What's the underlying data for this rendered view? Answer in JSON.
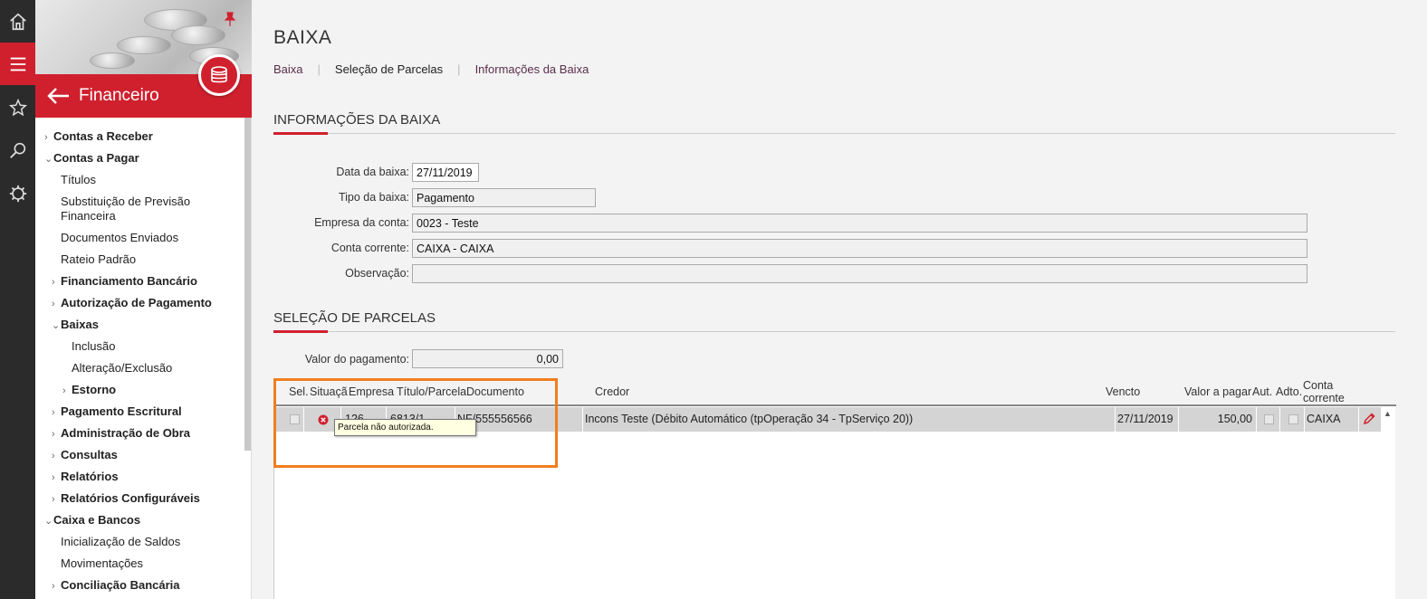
{
  "sidebar": {
    "title": "Financeiro",
    "menu": [
      {
        "label": "Contas a Receber"
      },
      {
        "label": "Contas a Pagar"
      },
      {
        "label": "Títulos"
      },
      {
        "label": "Substituição de Previsão Financeira"
      },
      {
        "label": "Documentos Enviados"
      },
      {
        "label": "Rateio Padrão"
      },
      {
        "label": "Financiamento Bancário"
      },
      {
        "label": "Autorização de Pagamento"
      },
      {
        "label": "Baixas"
      },
      {
        "label": "Inclusão"
      },
      {
        "label": "Alteração/Exclusão"
      },
      {
        "label": "Estorno"
      },
      {
        "label": "Pagamento Escritural"
      },
      {
        "label": "Administração de Obra"
      },
      {
        "label": "Consultas"
      },
      {
        "label": "Relatórios"
      },
      {
        "label": "Relatórios Configuráveis"
      },
      {
        "label": "Caixa e Bancos"
      },
      {
        "label": "Inicialização de Saldos"
      },
      {
        "label": "Movimentações"
      },
      {
        "label": "Conciliação Bancária"
      }
    ]
  },
  "page": {
    "title": "BAIXA",
    "breadcrumbs": [
      "Baixa",
      "Seleção de Parcelas",
      "Informações da Baixa"
    ]
  },
  "info_section": {
    "title": "INFORMAÇÕES DA BAIXA",
    "fields": {
      "data_label": "Data da baixa:",
      "data_value": "27/11/2019",
      "tipo_label": "Tipo da baixa:",
      "tipo_value": "Pagamento",
      "empresa_label": "Empresa da conta:",
      "empresa_value": "0023 - Teste",
      "conta_label": "Conta corrente:",
      "conta_value": "CAIXA - CAIXA",
      "obs_label": "Observação:",
      "obs_value": ""
    }
  },
  "parcelas_section": {
    "title": "SELEÇÃO DE PARCELAS",
    "valor_label": "Valor do pagamento:",
    "valor_value": "0,00",
    "columns": {
      "sel": "Sel.",
      "situacao": "Situaçã",
      "empresa": "Empresa",
      "titulo": "Título/Parcela",
      "documento": "Documento",
      "credor": "Credor",
      "vencto": "Vencto",
      "valor": "Valor a pagar",
      "aut": "Aut.",
      "adto": "Adto.",
      "conta_1": "Conta",
      "conta_2": "corrente"
    },
    "rows": [
      {
        "empresa": "126",
        "titulo": "6813/1",
        "documento": "NF/555556566",
        "credor": "Incons Teste (Débito Automático (tpOperação 34 - TpServiço 20))",
        "vencto": "27/11/2019",
        "valor": "150,00",
        "conta": "CAIXA"
      }
    ],
    "tooltip": "Parcela não autorizada."
  },
  "colors": {
    "accent": "#d0202e",
    "highlight": "#f07e20"
  }
}
